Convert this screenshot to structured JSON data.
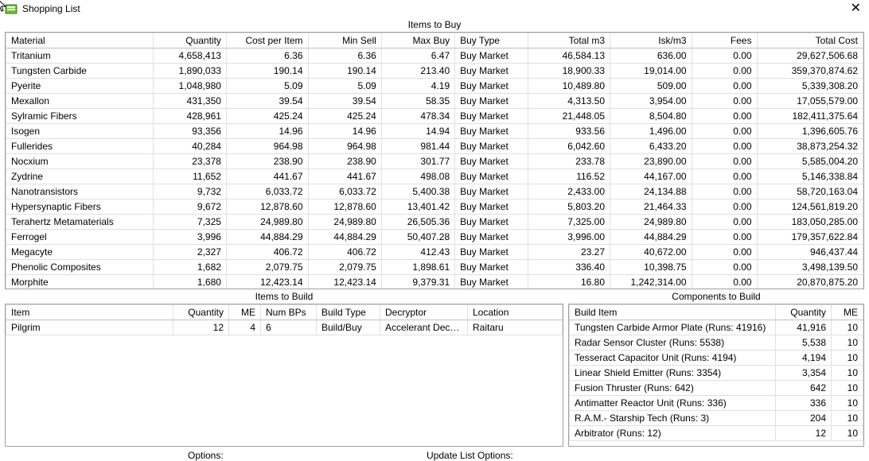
{
  "window": {
    "title": "Shopping List"
  },
  "itemsToBuy": {
    "title": "Items to Buy",
    "headers": {
      "material": "Material",
      "quantity": "Quantity",
      "costPerItem": "Cost per Item",
      "minSell": "Min Sell",
      "maxBuy": "Max Buy",
      "buyType": "Buy Type",
      "totalM3": "Total m3",
      "iskM3": "Isk/m3",
      "fees": "Fees",
      "totalCost": "Total Cost"
    },
    "rows": [
      {
        "material": "Tritanium",
        "quantity": "4,658,413",
        "costPerItem": "6.36",
        "minSell": "6.36",
        "maxBuy": "6.47",
        "buyType": "Buy Market",
        "totalM3": "46,584.13",
        "iskM3": "636.00",
        "fees": "0.00",
        "totalCost": "29,627,506.68"
      },
      {
        "material": "Tungsten Carbide",
        "quantity": "1,890,033",
        "costPerItem": "190.14",
        "minSell": "190.14",
        "maxBuy": "213.40",
        "buyType": "Buy Market",
        "totalM3": "18,900.33",
        "iskM3": "19,014.00",
        "fees": "0.00",
        "totalCost": "359,370,874.62"
      },
      {
        "material": "Pyerite",
        "quantity": "1,048,980",
        "costPerItem": "5.09",
        "minSell": "5.09",
        "maxBuy": "4.19",
        "buyType": "Buy Market",
        "totalM3": "10,489.80",
        "iskM3": "509.00",
        "fees": "0.00",
        "totalCost": "5,339,308.20"
      },
      {
        "material": "Mexallon",
        "quantity": "431,350",
        "costPerItem": "39.54",
        "minSell": "39.54",
        "maxBuy": "58.35",
        "buyType": "Buy Market",
        "totalM3": "4,313.50",
        "iskM3": "3,954.00",
        "fees": "0.00",
        "totalCost": "17,055,579.00"
      },
      {
        "material": "Sylramic Fibers",
        "quantity": "428,961",
        "costPerItem": "425.24",
        "minSell": "425.24",
        "maxBuy": "478.34",
        "buyType": "Buy Market",
        "totalM3": "21,448.05",
        "iskM3": "8,504.80",
        "fees": "0.00",
        "totalCost": "182,411,375.64"
      },
      {
        "material": "Isogen",
        "quantity": "93,356",
        "costPerItem": "14.96",
        "minSell": "14.96",
        "maxBuy": "14.94",
        "buyType": "Buy Market",
        "totalM3": "933.56",
        "iskM3": "1,496.00",
        "fees": "0.00",
        "totalCost": "1,396,605.76"
      },
      {
        "material": "Fullerides",
        "quantity": "40,284",
        "costPerItem": "964.98",
        "minSell": "964.98",
        "maxBuy": "981.44",
        "buyType": "Buy Market",
        "totalM3": "6,042.60",
        "iskM3": "6,433.20",
        "fees": "0.00",
        "totalCost": "38,873,254.32"
      },
      {
        "material": "Nocxium",
        "quantity": "23,378",
        "costPerItem": "238.90",
        "minSell": "238.90",
        "maxBuy": "301.77",
        "buyType": "Buy Market",
        "totalM3": "233.78",
        "iskM3": "23,890.00",
        "fees": "0.00",
        "totalCost": "5,585,004.20"
      },
      {
        "material": "Zydrine",
        "quantity": "11,652",
        "costPerItem": "441.67",
        "minSell": "441.67",
        "maxBuy": "498.08",
        "buyType": "Buy Market",
        "totalM3": "116.52",
        "iskM3": "44,167.00",
        "fees": "0.00",
        "totalCost": "5,146,338.84"
      },
      {
        "material": "Nanotransistors",
        "quantity": "9,732",
        "costPerItem": "6,033.72",
        "minSell": "6,033.72",
        "maxBuy": "5,400.38",
        "buyType": "Buy Market",
        "totalM3": "2,433.00",
        "iskM3": "24,134.88",
        "fees": "0.00",
        "totalCost": "58,720,163.04"
      },
      {
        "material": "Hypersynaptic Fibers",
        "quantity": "9,672",
        "costPerItem": "12,878.60",
        "minSell": "12,878.60",
        "maxBuy": "13,401.42",
        "buyType": "Buy Market",
        "totalM3": "5,803.20",
        "iskM3": "21,464.33",
        "fees": "0.00",
        "totalCost": "124,561,819.20"
      },
      {
        "material": "Terahertz Metamaterials",
        "quantity": "7,325",
        "costPerItem": "24,989.80",
        "minSell": "24,989.80",
        "maxBuy": "26,505.36",
        "buyType": "Buy Market",
        "totalM3": "7,325.00",
        "iskM3": "24,989.80",
        "fees": "0.00",
        "totalCost": "183,050,285.00"
      },
      {
        "material": "Ferrogel",
        "quantity": "3,996",
        "costPerItem": "44,884.29",
        "minSell": "44,884.29",
        "maxBuy": "50,407.28",
        "buyType": "Buy Market",
        "totalM3": "3,996.00",
        "iskM3": "44,884.29",
        "fees": "0.00",
        "totalCost": "179,357,622.84"
      },
      {
        "material": "Megacyte",
        "quantity": "2,327",
        "costPerItem": "406.72",
        "minSell": "406.72",
        "maxBuy": "412.43",
        "buyType": "Buy Market",
        "totalM3": "23.27",
        "iskM3": "40,672.00",
        "fees": "0.00",
        "totalCost": "946,437.44"
      },
      {
        "material": "Phenolic Composites",
        "quantity": "1,682",
        "costPerItem": "2,079.75",
        "minSell": "2,079.75",
        "maxBuy": "1,898.61",
        "buyType": "Buy Market",
        "totalM3": "336.40",
        "iskM3": "10,398.75",
        "fees": "0.00",
        "totalCost": "3,498,139.50"
      },
      {
        "material": "Morphite",
        "quantity": "1,680",
        "costPerItem": "12,423.14",
        "minSell": "12,423.14",
        "maxBuy": "9,379.31",
        "buyType": "Buy Market",
        "totalM3": "16.80",
        "iskM3": "1,242,314.00",
        "fees": "0.00",
        "totalCost": "20,870,875.20"
      }
    ]
  },
  "itemsToBuild": {
    "title": "Items to Build",
    "headers": {
      "item": "Item",
      "quantity": "Quantity",
      "me": "ME",
      "numBps": "Num BPs",
      "buildType": "Build Type",
      "decryptor": "Decryptor",
      "location": "Location"
    },
    "rows": [
      {
        "item": "Pilgrim",
        "quantity": "12",
        "me": "4",
        "numBps": "6",
        "buildType": "Build/Buy",
        "decryptor": "Accelerant Decry…",
        "location": "Raitaru"
      }
    ]
  },
  "componentsToBuild": {
    "title": "Components to Build",
    "headers": {
      "buildItem": "Build Item",
      "quantity": "Quantity",
      "me": "ME"
    },
    "rows": [
      {
        "buildItem": "Tungsten Carbide Armor Plate (Runs: 41916)",
        "quantity": "41,916",
        "me": "10"
      },
      {
        "buildItem": "Radar Sensor Cluster (Runs: 5538)",
        "quantity": "5,538",
        "me": "10"
      },
      {
        "buildItem": "Tesseract Capacitor Unit (Runs: 4194)",
        "quantity": "4,194",
        "me": "10"
      },
      {
        "buildItem": "Linear Shield Emitter (Runs: 3354)",
        "quantity": "3,354",
        "me": "10"
      },
      {
        "buildItem": "Fusion Thruster (Runs: 642)",
        "quantity": "642",
        "me": "10"
      },
      {
        "buildItem": "Antimatter Reactor Unit (Runs: 336)",
        "quantity": "336",
        "me": "10"
      },
      {
        "buildItem": "R.A.M.- Starship Tech (Runs: 3)",
        "quantity": "204",
        "me": "10"
      },
      {
        "buildItem": "Arbitrator (Runs: 12)",
        "quantity": "12",
        "me": "10"
      }
    ]
  },
  "footer": {
    "optionsLabel": "Options:",
    "updateLabel": "Update List Options:"
  }
}
